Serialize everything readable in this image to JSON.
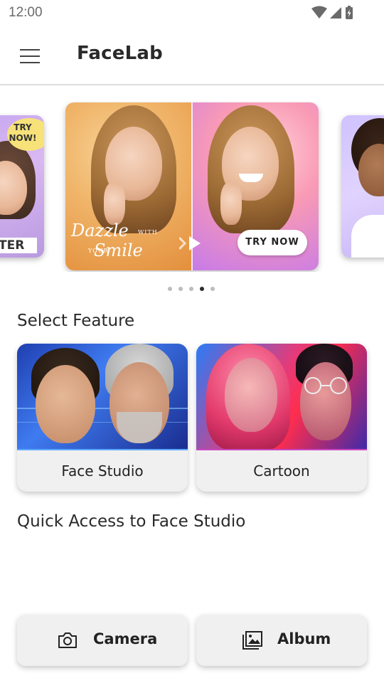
{
  "status_bar": {
    "time": "12:00",
    "icons": [
      "wifi-icon",
      "signal-icon",
      "battery-icon"
    ]
  },
  "app_bar": {
    "title": "FaceLab",
    "menu_icon": "menu-icon"
  },
  "carousel": {
    "main_slide": {
      "headline_line1": "Dazzle",
      "headline_small1": "WITH",
      "headline_small2": "YOUR",
      "headline_line2": "Smile",
      "button_label": "TRY NOW"
    },
    "left_slide": {
      "badge": "TRY NOW!",
      "label": "TER"
    },
    "dot_count": 5,
    "active_dot": 3
  },
  "features": {
    "title": "Select Feature",
    "items": [
      {
        "label": "Face Studio"
      },
      {
        "label": "Cartoon"
      }
    ]
  },
  "quick_access": {
    "title": "Quick Access to Face Studio"
  },
  "actions": {
    "camera_label": "Camera",
    "album_label": "Album"
  },
  "colors": {
    "text": "#222222",
    "card_bg": "#f0f0f0",
    "divider": "#dcdcdc"
  }
}
